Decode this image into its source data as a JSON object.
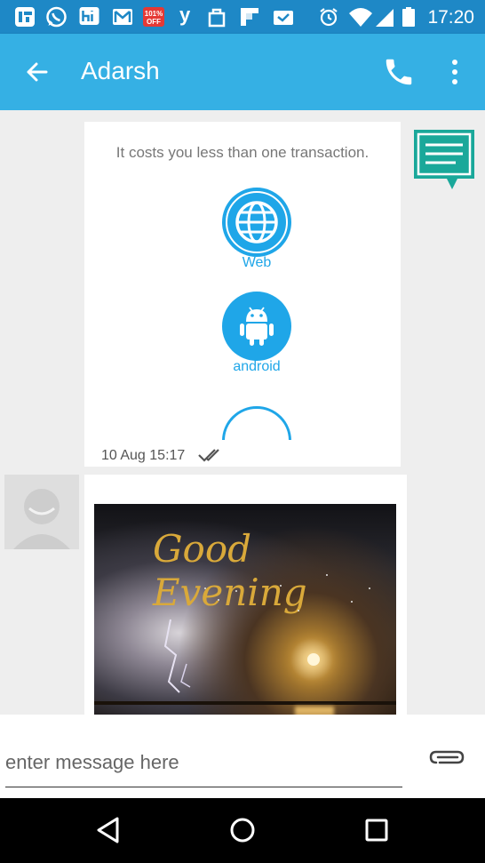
{
  "status_bar": {
    "time": "17:20",
    "notification_icons": [
      "ifttt-icon",
      "whatsapp-icon",
      "hike-icon",
      "gmail-icon",
      "offer-icon",
      "yatra-icon",
      "shopping-bag-icon",
      "flipboard-icon",
      "mail-check-icon"
    ],
    "offer_badge": "101% OFF",
    "yatra_letter": "y",
    "system_icons": [
      "alarm-icon",
      "wifi-icon",
      "signal-icon",
      "battery-icon"
    ]
  },
  "app_bar": {
    "title": "Adarsh",
    "back_icon": "arrow-back-icon",
    "call_icon": "phone-icon",
    "menu_icon": "more-vert-icon"
  },
  "messages": [
    {
      "type": "image",
      "direction": "outgoing",
      "caption_text": "It costs you less than one transaction.",
      "platforms": [
        {
          "label": "Web",
          "icon": "globe-icon"
        },
        {
          "label": "android",
          "icon": "android-icon"
        }
      ],
      "timestamp": "10 Aug 15:17",
      "status_icon": "double-check-icon"
    },
    {
      "type": "image",
      "direction": "incoming",
      "image_text": "Good Evening",
      "avatar_icon": "default-avatar-icon"
    }
  ],
  "composer": {
    "placeholder": "enter message here",
    "value": "",
    "attach_icon": "paperclip-icon"
  },
  "nav_bar": {
    "icons": [
      "nav-back-icon",
      "nav-home-icon",
      "nav-recents-icon"
    ]
  },
  "colors": {
    "status_bar": "#1e88c6",
    "app_bar": "#35b0e4",
    "accent": "#1fa6e8",
    "chat_icon": "#1aa89a"
  }
}
